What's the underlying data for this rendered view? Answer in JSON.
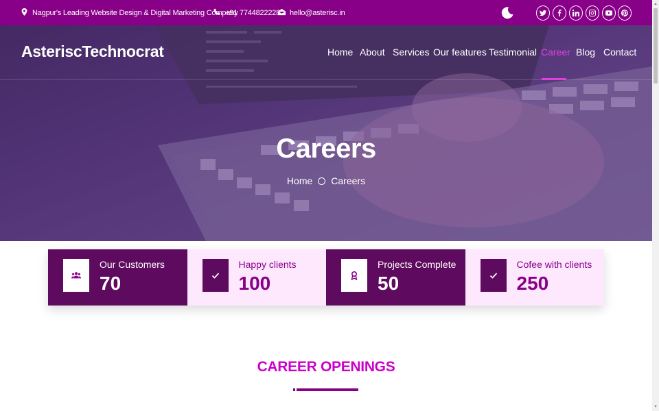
{
  "topbar": {
    "tagline": "Nagpur's Leading Website Design & Digital Marketing Company",
    "phone": "+91 7744822228",
    "email": "hello@asterisc.in",
    "icons": [
      "map-marker-icon",
      "phone-icon",
      "envelope-icon",
      "moon-icon"
    ],
    "social": [
      "twitter",
      "facebook",
      "linkedin",
      "instagram",
      "youtube",
      "pinterest"
    ]
  },
  "header": {
    "logo": "AsteriscTechnocrat",
    "nav": [
      "Home",
      "About",
      "Services",
      "Our features",
      "Testimonial",
      "Career",
      "Blog",
      "Contact"
    ],
    "active_nav": "Career"
  },
  "hero": {
    "title": "Careers",
    "breadcrumb": [
      "Home",
      "Careers"
    ]
  },
  "stats": [
    {
      "label": "Our Customers",
      "value": "70",
      "icon": "users-icon",
      "style": "dark"
    },
    {
      "label": "Happy clients",
      "value": "100",
      "icon": "check-icon",
      "style": "light"
    },
    {
      "label": "Projects Complete",
      "value": "50",
      "icon": "award-icon",
      "style": "dark"
    },
    {
      "label": "Cofee with clients",
      "value": "250",
      "icon": "check-icon",
      "style": "light"
    }
  ],
  "section": {
    "title": "CAREER OPENINGS"
  },
  "colors": {
    "brand": "#880088",
    "accent": "#e040e0",
    "dark_tile": "#5e0a5e",
    "light_tile": "#fde8fd"
  }
}
